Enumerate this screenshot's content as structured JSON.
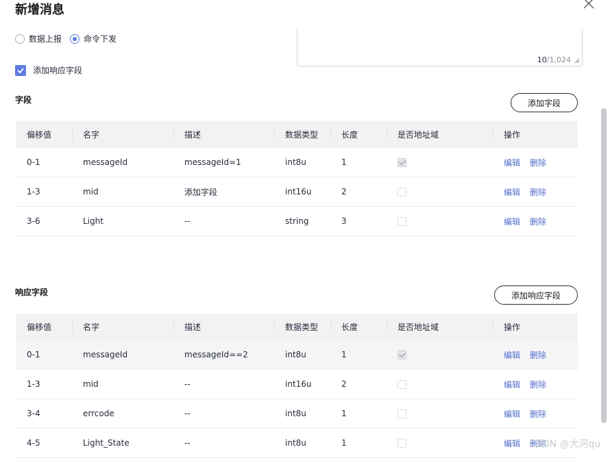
{
  "dialog": {
    "title": "新增消息"
  },
  "message_type": {
    "options": [
      "数据上报",
      "命令下发"
    ],
    "selected": "命令下发"
  },
  "response_field_checkbox": {
    "label": "添加响应字段",
    "checked": true
  },
  "description_area": {
    "count": "10",
    "max": "/1,024"
  },
  "fields_section": {
    "title": "字段",
    "add_button": "添加字段",
    "columns": [
      "偏移值",
      "名字",
      "描述",
      "数据类型",
      "长度",
      "是否地址域",
      "操作"
    ],
    "rows": [
      {
        "offset": "0-1",
        "name": "messageId",
        "desc": "messageId=1",
        "type": "int8u",
        "length": "1",
        "is_address": true,
        "disabled": true,
        "edit": "编辑",
        "delete": "删除"
      },
      {
        "offset": "1-3",
        "name": "mid",
        "desc": "添加字段",
        "type": "int16u",
        "length": "2",
        "is_address": false,
        "disabled": true,
        "edit": "编辑",
        "delete": "删除"
      },
      {
        "offset": "3-6",
        "name": "Light",
        "desc": "--",
        "type": "string",
        "length": "3",
        "is_address": false,
        "disabled": true,
        "edit": "编辑",
        "delete": "删除"
      }
    ]
  },
  "response_section": {
    "title": "响应字段",
    "add_button": "添加响应字段",
    "columns": [
      "偏移值",
      "名字",
      "描述",
      "数据类型",
      "长度",
      "是否地址域",
      "操作"
    ],
    "rows": [
      {
        "offset": "0-1",
        "name": "messageId",
        "desc": "messageId==2",
        "type": "int8u",
        "length": "1",
        "is_address": true,
        "disabled": true,
        "edit": "编辑",
        "delete": "删除"
      },
      {
        "offset": "1-3",
        "name": "mid",
        "desc": "--",
        "type": "int16u",
        "length": "2",
        "is_address": false,
        "disabled": true,
        "edit": "编辑",
        "delete": "删除"
      },
      {
        "offset": "3-4",
        "name": "errcode",
        "desc": "--",
        "type": "int8u",
        "length": "1",
        "is_address": false,
        "disabled": true,
        "edit": "编辑",
        "delete": "删除"
      },
      {
        "offset": "4-5",
        "name": "Light_State",
        "desc": "--",
        "type": "int8u",
        "length": "1",
        "is_address": false,
        "disabled": true,
        "edit": "编辑",
        "delete": "删除"
      }
    ]
  },
  "watermark": "CSDN @大河qu",
  "colors": {
    "accent": "#5e7ce0",
    "link": "#526ecc",
    "header_bg": "#f2f2f3"
  }
}
